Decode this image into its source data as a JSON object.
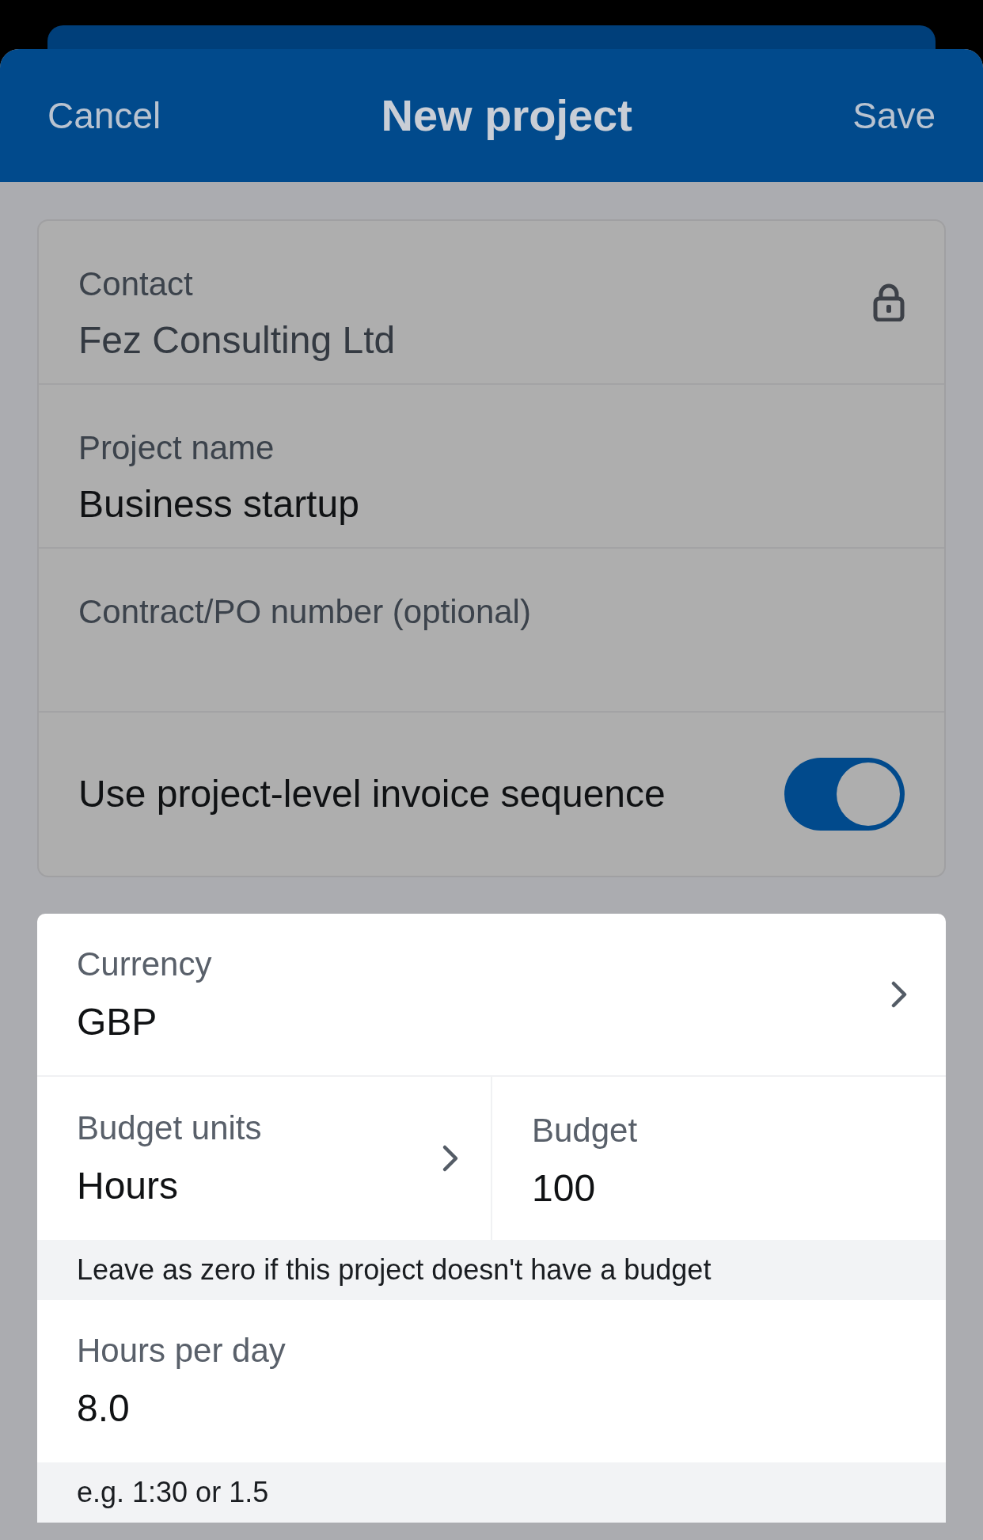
{
  "header": {
    "cancel": "Cancel",
    "title": "New project",
    "save": "Save"
  },
  "project_card": {
    "fields": [
      {
        "kind": "locked",
        "label": "Contact",
        "value": "Fez Consulting Ltd"
      },
      {
        "kind": "text",
        "label": "Project name",
        "value": "Business startup"
      },
      {
        "kind": "text",
        "label": "Contract/PO number (optional)"
      }
    ],
    "toggle": {
      "label": "Use project-level invoice sequence",
      "on": true
    }
  },
  "budget_card": {
    "currency": {
      "label": "Currency",
      "value": "GBP"
    },
    "budget_units": {
      "label": "Budget units",
      "value": "Hours"
    },
    "budget": {
      "label": "Budget",
      "value": "100"
    },
    "budget_hint": "Leave as zero if this project doesn't have a budget",
    "hours_per_day": {
      "label": "Hours per day",
      "value": "8.0"
    },
    "hours_hint": "e.g. 1:30 or 1.5"
  }
}
